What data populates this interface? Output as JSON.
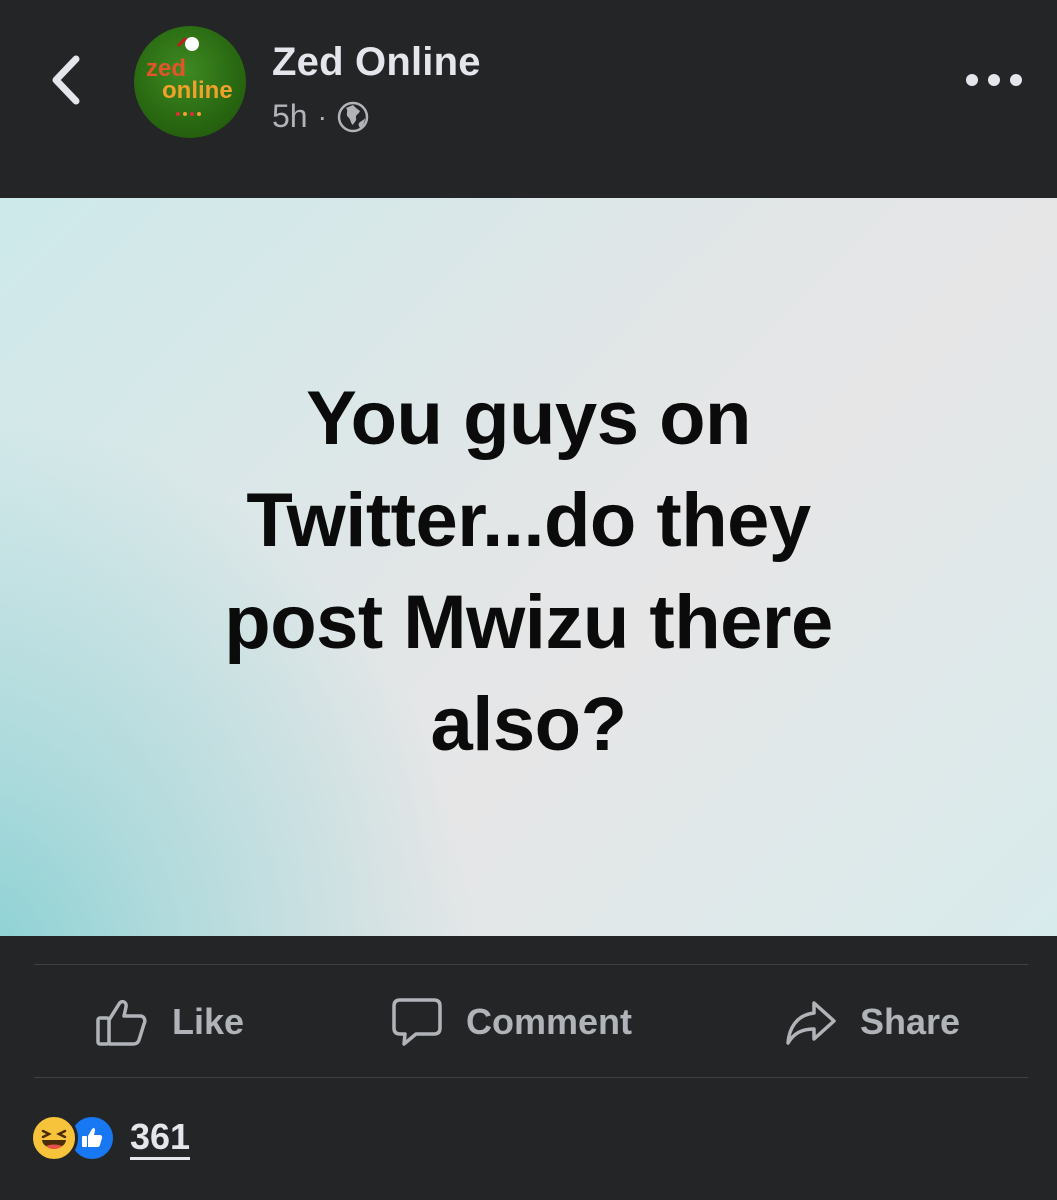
{
  "header": {
    "page_name": "Zed Online",
    "time": "5h",
    "separator": "·",
    "privacy_icon": "globe-icon",
    "back_icon": "chevron-left-icon",
    "more_icon": "more-horizontal-icon",
    "avatar": {
      "logo_line1": "zed",
      "logo_line2": "online"
    }
  },
  "post": {
    "lines": [
      "You guys on",
      "Twitter...do they",
      "post Mwizu there",
      "also?"
    ]
  },
  "actions": {
    "like": {
      "label": "Like",
      "icon": "thumbs-up-icon"
    },
    "comment": {
      "label": "Comment",
      "icon": "comment-icon"
    },
    "share": {
      "label": "Share",
      "icon": "share-arrow-icon"
    }
  },
  "reactions": {
    "icons": [
      "haha-reaction-icon",
      "like-reaction-icon"
    ],
    "count": "361"
  },
  "colors": {
    "background": "#242526",
    "text_primary": "#e4e6eb",
    "text_secondary": "#b0b3b8",
    "like_blue": "#1877f2",
    "haha_yellow": "#f7c33b"
  }
}
